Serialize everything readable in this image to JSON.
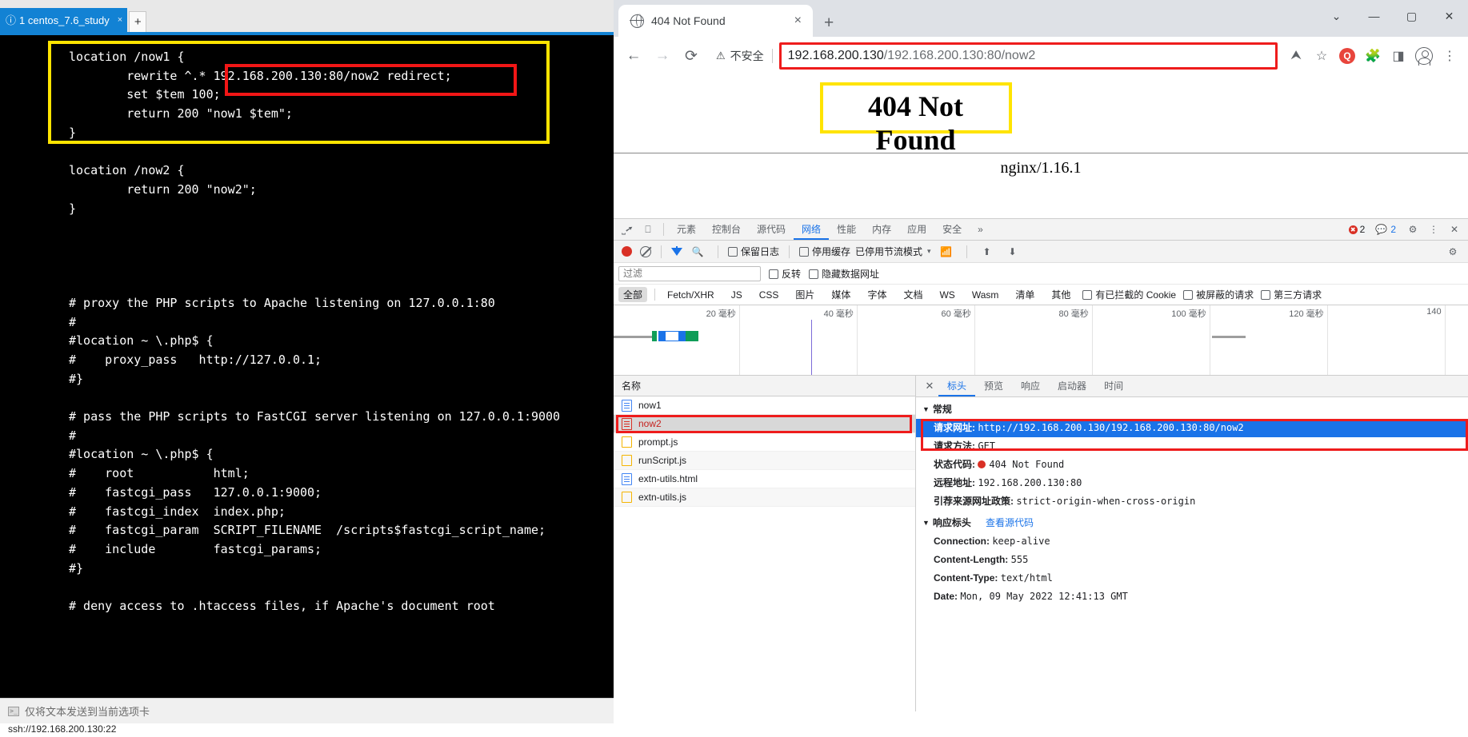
{
  "terminal": {
    "tab": {
      "warn_icon": "warning-circle",
      "title": "1 centos_7.6_study",
      "title_underline": "1",
      "close": "×"
    },
    "new_tab_label": "+",
    "lines": [
      "location /now1 {",
      "        rewrite ^.* 192.168.200.130:80/now2 redirect;",
      "        set $tem 100;",
      "        return 200 \"now1 $tem\";",
      "}",
      "",
      "location /now2 {",
      "        return 200 \"now2\";",
      "}",
      "",
      "",
      "",
      "",
      "# proxy the PHP scripts to Apache listening on 127.0.0.1:80",
      "#",
      "#location ~ \\.php$ {",
      "#    proxy_pass   http://127.0.0.1;",
      "#}",
      "",
      "# pass the PHP scripts to FastCGI server listening on 127.0.0.1:9000",
      "#",
      "#location ~ \\.php$ {",
      "#    root           html;",
      "#    fastcgi_pass   127.0.0.1:9000;",
      "#    fastcgi_index  index.php;",
      "#    fastcgi_param  SCRIPT_FILENAME  /scripts$fastcgi_script_name;",
      "#    include        fastcgi_params;",
      "#}",
      "",
      "# deny access to .htaccess files, if Apache's document root"
    ],
    "status_bar_text": "仅将文本发送到当前选项卡",
    "footer_text": "ssh://192.168.200.130:22",
    "annotation_colors": {
      "yellow": "#ffe400",
      "red": "#f21616"
    }
  },
  "browser": {
    "tab": {
      "title": "404 Not Found",
      "close": "×",
      "favicon": "globe-icon"
    },
    "new_tab": "+",
    "window_controls": {
      "minimize_extra": "⌄",
      "minimize": "—",
      "maximize": "▢",
      "close": "✕"
    },
    "toolbar": {
      "back": "←",
      "forward": "→",
      "reload": "⟳",
      "security_warning_icon": "⚠",
      "security_label": "不安全",
      "url_primary": "192.168.200.130",
      "url_secondary": "/192.168.200.130:80/now2",
      "share_icon": "share-icon",
      "star_icon": "☆",
      "ext_badge": "Q",
      "puzzle_icon": "extensions-icon",
      "sidepanel_icon": "side-panel-icon",
      "profile_icon": "avatar-icon",
      "menu_icon": "⋮"
    },
    "page": {
      "heading": "404 Not Found",
      "server": "nginx/1.16.1"
    }
  },
  "devtools": {
    "left_icons": {
      "inspect": "inspect-icon",
      "device": "device-toolbar-icon"
    },
    "tabs": [
      {
        "label": "元素",
        "active": false
      },
      {
        "label": "控制台",
        "active": false
      },
      {
        "label": "源代码",
        "active": false
      },
      {
        "label": "网络",
        "active": true
      },
      {
        "label": "性能",
        "active": false
      },
      {
        "label": "内存",
        "active": false
      },
      {
        "label": "应用",
        "active": false
      },
      {
        "label": "安全",
        "active": false
      },
      {
        "label": "»",
        "active": false
      }
    ],
    "error_count": "2",
    "message_count": "2",
    "settings_icon": "gear-icon",
    "more_icon": "⋮",
    "close_icon": "✕",
    "toolbar2": {
      "record": "record-icon",
      "clear": "clear-icon",
      "filter": "filter-icon",
      "search": "search-icon",
      "preserve_log": "保留日志",
      "disable_cache": "停用缓存",
      "throttling": "已停用节流模式",
      "throttle_caret": "▾",
      "wifi_icon": "network-conditions-icon",
      "import_icon": "import-har-icon",
      "export_icon": "export-har-icon",
      "settings_icon": "gear-icon"
    },
    "filter_row": {
      "placeholder": "过滤",
      "invert": "反转",
      "hide_data_urls": "隐藏数据网址"
    },
    "type_filters": [
      {
        "label": "全部",
        "active": true
      },
      {
        "label": "Fetch/XHR",
        "active": false
      },
      {
        "label": "JS",
        "active": false
      },
      {
        "label": "CSS",
        "active": false
      },
      {
        "label": "图片",
        "active": false
      },
      {
        "label": "媒体",
        "active": false
      },
      {
        "label": "字体",
        "active": false
      },
      {
        "label": "文档",
        "active": false
      },
      {
        "label": "WS",
        "active": false
      },
      {
        "label": "Wasm",
        "active": false
      },
      {
        "label": "清单",
        "active": false
      },
      {
        "label": "其他",
        "active": false
      }
    ],
    "type_checkboxes": [
      {
        "label": "有已拦截的 Cookie"
      },
      {
        "label": "被屏蔽的请求"
      },
      {
        "label": "第三方请求"
      }
    ],
    "overview_ticks": [
      "20 毫秒",
      "40 毫秒",
      "60 毫秒",
      "80 毫秒",
      "100 毫秒",
      "120 毫秒",
      "140"
    ],
    "request_list": {
      "column_header": "名称",
      "rows": [
        {
          "name": "now1",
          "icon": "document-icon",
          "selected": false
        },
        {
          "name": "now2",
          "icon": "document-icon",
          "selected": true
        },
        {
          "name": "prompt.js",
          "icon": "script-icon",
          "selected": false
        },
        {
          "name": "runScript.js",
          "icon": "script-icon",
          "selected": false
        },
        {
          "name": "extn-utils.html",
          "icon": "document-icon",
          "selected": false
        },
        {
          "name": "extn-utils.js",
          "icon": "script-icon",
          "selected": false
        }
      ]
    },
    "detail": {
      "close": "✕",
      "tabs": [
        {
          "label": "标头",
          "active": true
        },
        {
          "label": "预览",
          "active": false
        },
        {
          "label": "响应",
          "active": false
        },
        {
          "label": "启动器",
          "active": false
        },
        {
          "label": "时间",
          "active": false
        }
      ],
      "general_section": "常规",
      "general": [
        {
          "key": "请求网址:",
          "value": "http://192.168.200.130/192.168.200.130:80/now2",
          "highlight": true
        },
        {
          "key": "请求方法:",
          "value": "GET",
          "highlight": false
        },
        {
          "key": "状态代码:",
          "value": "404 Not Found",
          "status_dot": true,
          "highlight": false
        },
        {
          "key": "远程地址:",
          "value": "192.168.200.130:80",
          "highlight": false
        },
        {
          "key": "引荐来源网址政策:",
          "value": "strict-origin-when-cross-origin",
          "highlight": false
        }
      ],
      "response_section": "响应标头",
      "response_section_link": "查看源代码",
      "response_headers": [
        {
          "key": "Connection:",
          "value": "keep-alive"
        },
        {
          "key": "Content-Length:",
          "value": "555"
        },
        {
          "key": "Content-Type:",
          "value": "text/html"
        },
        {
          "key": "Date:",
          "value": "Mon, 09 May 2022 12:41:13 GMT"
        }
      ]
    }
  }
}
